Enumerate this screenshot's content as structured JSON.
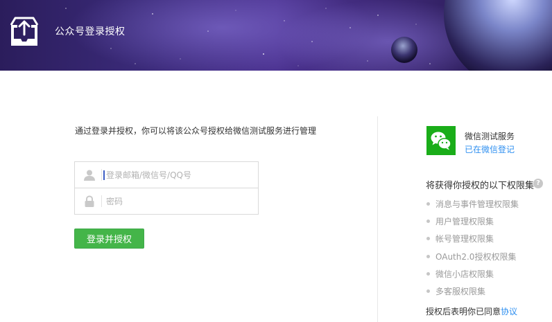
{
  "header": {
    "title": "公众号登录授权",
    "logo_icon": "upload-tray-icon"
  },
  "login": {
    "intro": "通过登录并授权，你可以将该公众号授权给微信测试服务进行管理",
    "username_placeholder": "登录邮箱/微信号/QQ号",
    "password_placeholder": "密码",
    "username_icon": "user-icon",
    "password_icon": "lock-icon",
    "submit_label": "登录并授权",
    "submit_color": "#44b549"
  },
  "service": {
    "logo_icon": "wechat-icon",
    "name": "微信测试服务",
    "status": "已在微信登记",
    "status_color": "#2e8ff0"
  },
  "permissions": {
    "title": "将获得你授权的以下权限集",
    "help_icon": "question-icon",
    "help_label": "?",
    "items": [
      "消息与事件管理权限集",
      "用户管理权限集",
      "帐号管理权限集",
      "OAuth2.0授权权限集",
      "微信小店权限集",
      "多客服权限集"
    ]
  },
  "agreement": {
    "text": "授权后表明你已同意",
    "link": "协议"
  }
}
